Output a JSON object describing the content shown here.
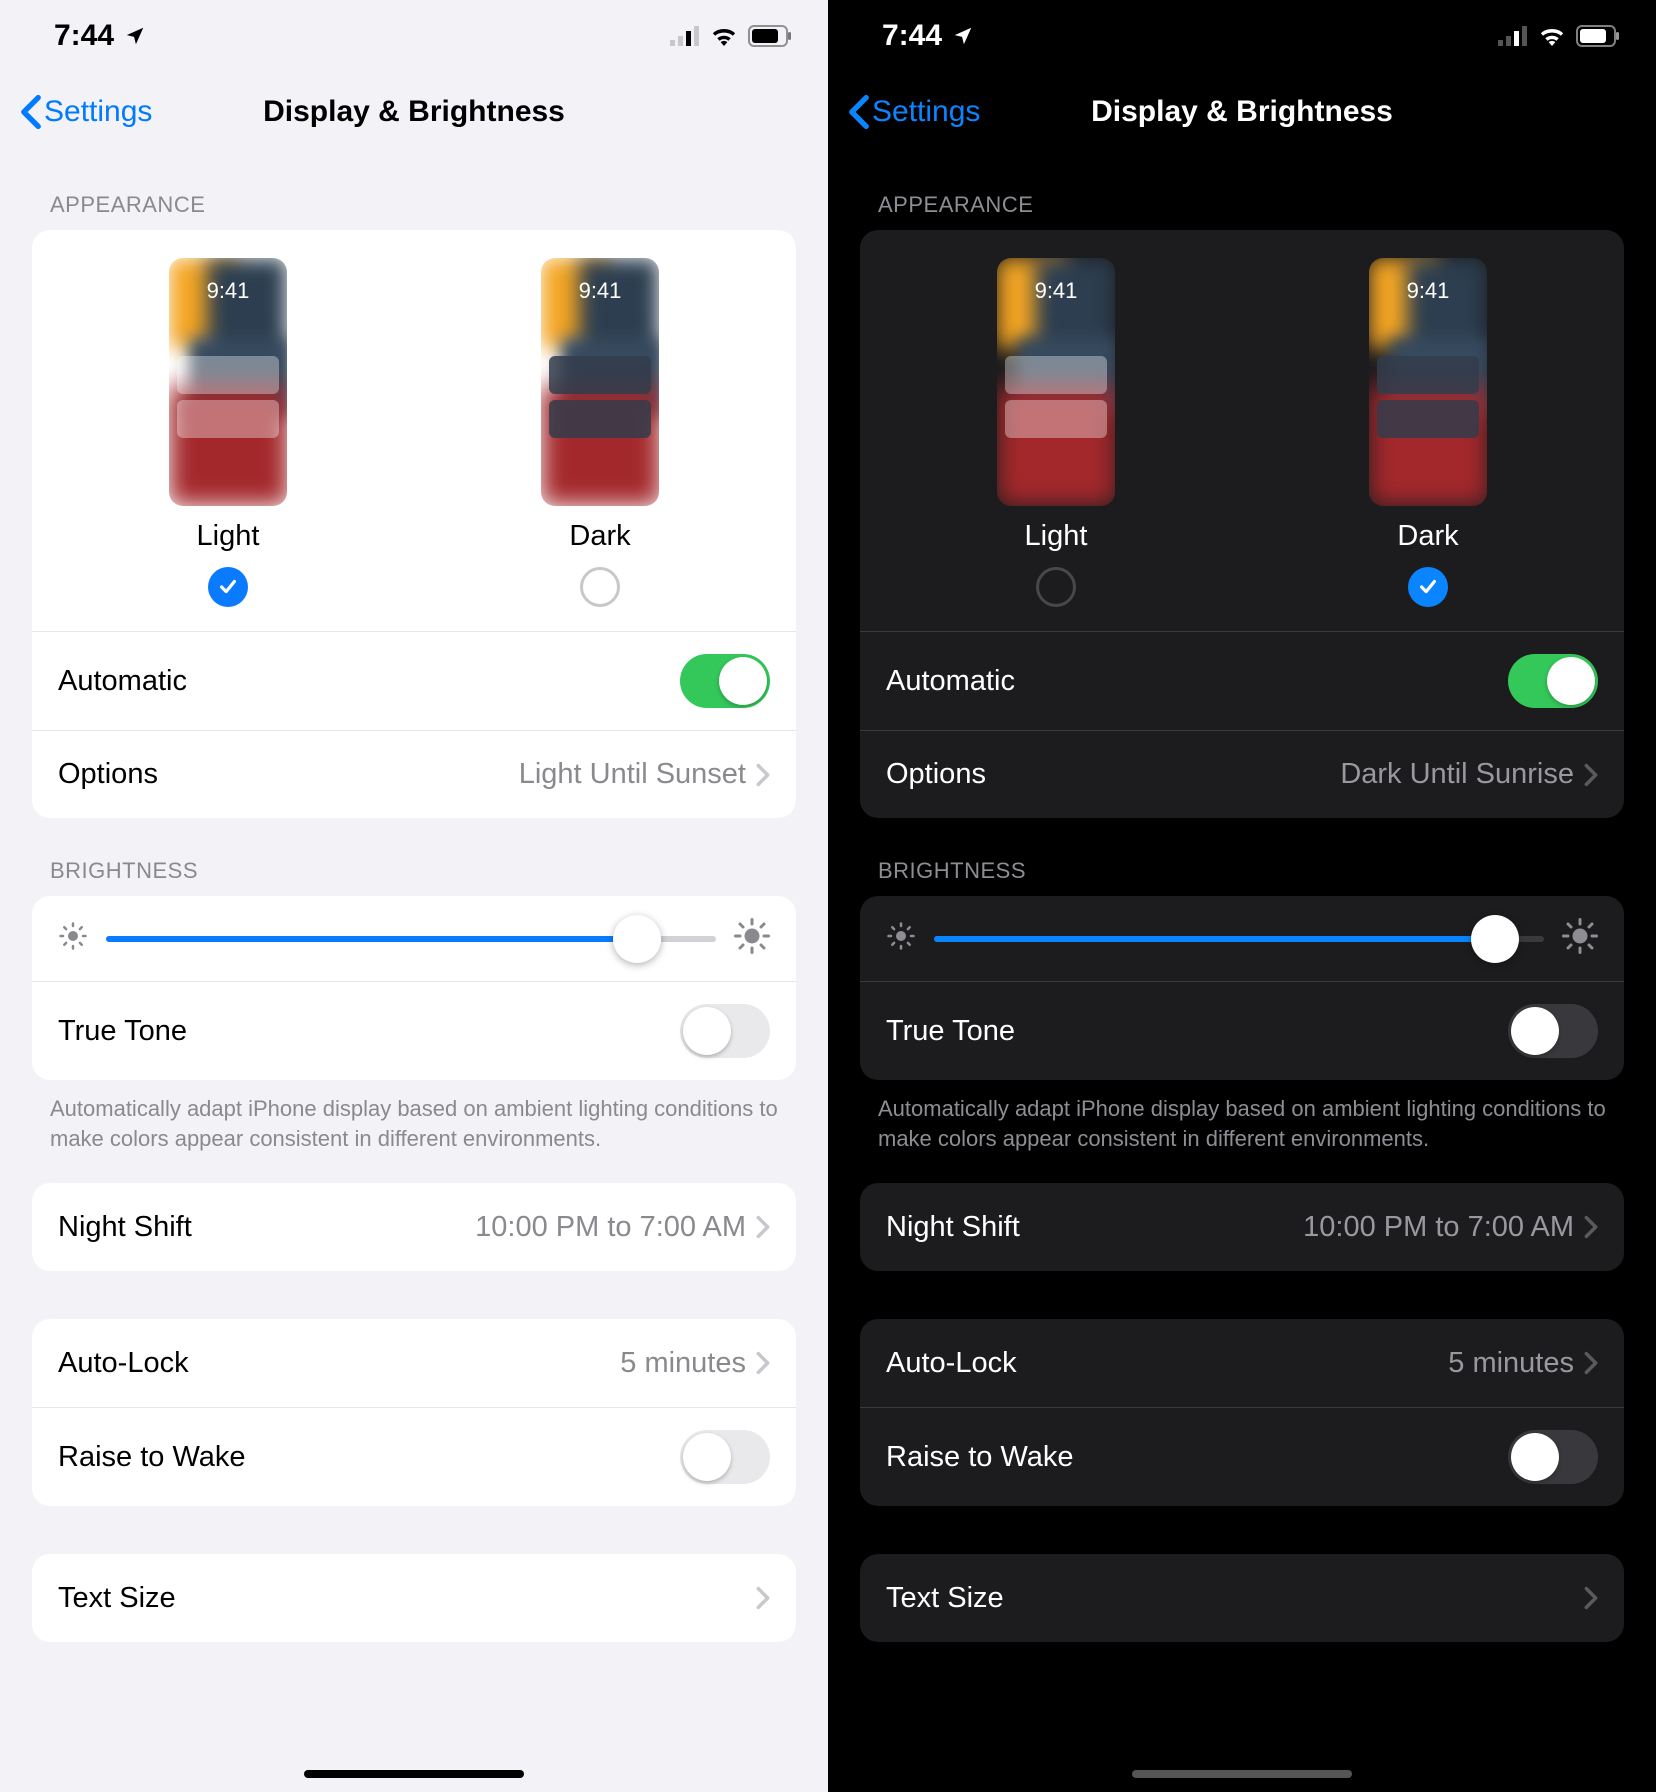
{
  "statusbar": {
    "time": "7:44"
  },
  "nav": {
    "back": "Settings",
    "title": "Display & Brightness"
  },
  "appearance": {
    "header": "APPEARANCE",
    "preview_time": "9:41",
    "light_label": "Light",
    "dark_label": "Dark",
    "automatic_label": "Automatic",
    "options_label": "Options",
    "options_value_light": "Light Until Sunset",
    "options_value_dark": "Dark Until Sunrise"
  },
  "brightness": {
    "header": "BRIGHTNESS",
    "truetone_label": "True Tone",
    "truetone_note": "Automatically adapt iPhone display based on ambient lighting conditions to make colors appear consistent in different environments.",
    "slider_value_light": 87,
    "slider_value_dark": 92
  },
  "nightshift": {
    "label": "Night Shift",
    "value": "10:00 PM to 7:00 AM"
  },
  "autolock": {
    "label": "Auto-Lock",
    "value": "5 minutes",
    "raise_label": "Raise to Wake"
  },
  "textsize": {
    "label": "Text Size"
  }
}
